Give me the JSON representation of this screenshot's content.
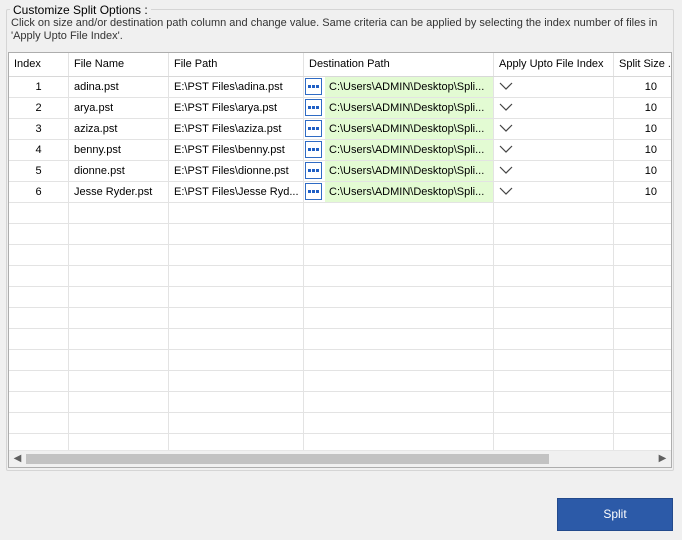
{
  "group": {
    "title": "Customize Split Options :",
    "description": "Click on size and/or destination path column and change value. Same criteria can be applied by selecting the index number of files in 'Apply Upto File Index'."
  },
  "table": {
    "columns": [
      "Index",
      "File Name",
      "File Path",
      "Destination Path",
      "Apply Upto File Index",
      "Split Size ..."
    ],
    "rows": [
      {
        "index": "1",
        "name": "adina.pst",
        "path": "E:\\PST Files\\adina.pst",
        "dest": "C:\\Users\\ADMIN\\Desktop\\Spli...",
        "size": "10"
      },
      {
        "index": "2",
        "name": "arya.pst",
        "path": "E:\\PST Files\\arya.pst",
        "dest": "C:\\Users\\ADMIN\\Desktop\\Spli...",
        "size": "10"
      },
      {
        "index": "3",
        "name": "aziza.pst",
        "path": "E:\\PST Files\\aziza.pst",
        "dest": "C:\\Users\\ADMIN\\Desktop\\Spli...",
        "size": "10"
      },
      {
        "index": "4",
        "name": "benny.pst",
        "path": "E:\\PST Files\\benny.pst",
        "dest": "C:\\Users\\ADMIN\\Desktop\\Spli...",
        "size": "10"
      },
      {
        "index": "5",
        "name": "dionne.pst",
        "path": "E:\\PST Files\\dionne.pst",
        "dest": "C:\\Users\\ADMIN\\Desktop\\Spli...",
        "size": "10"
      },
      {
        "index": "6",
        "name": "Jesse Ryder.pst",
        "path": "E:\\PST Files\\Jesse Ryd...",
        "dest": "C:\\Users\\ADMIN\\Desktop\\Spli...",
        "size": "10"
      }
    ]
  },
  "icons": {
    "browse": "ellipsis-icon",
    "apply_dropdown": "chevron-down-icon",
    "scroll_left": "scroll-left-arrow-icon",
    "scroll_right": "scroll-right-arrow-icon"
  },
  "actions": {
    "split_label": "Split"
  },
  "colors": {
    "destination_cell": "#e3fbd3",
    "button": "#2c5aa8",
    "browse_icon": "#1f5fc5"
  }
}
